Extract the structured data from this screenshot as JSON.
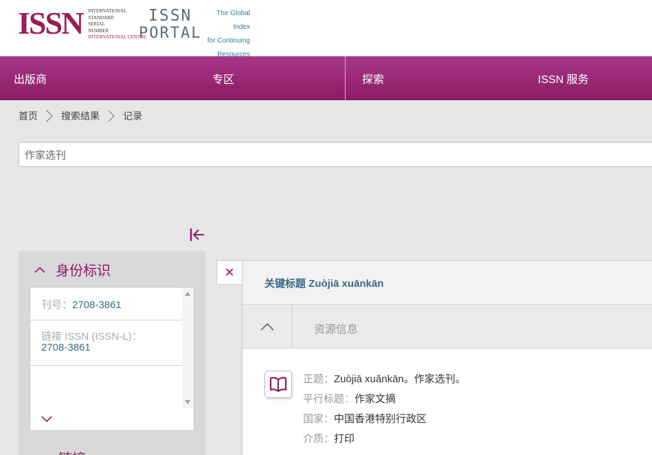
{
  "logo": {
    "issn_letters": "ISSN",
    "lines": [
      "INTERNATIONAL",
      "STANDARD",
      "SERIAL",
      "NUMBER",
      "INTERNATIONAL CENTRE"
    ],
    "portal_issn": "ISSN",
    "portal_word": "PORTAL",
    "tagline": [
      "The Global Index",
      "for Continuing",
      "Resources"
    ]
  },
  "nav": [
    "出版商",
    "专区",
    "探索",
    "ISSN 服务"
  ],
  "breadcrumb": [
    "首页",
    "搜索结果",
    "记录"
  ],
  "search": {
    "value": "作家选刊"
  },
  "identity": {
    "title": "身份标识",
    "issn_label": "刊号：",
    "issn_value": "2708-3861",
    "linking_label": "链接 ISSN (ISSN-L)：",
    "linking_value": "2708-3861",
    "next_section": "链接"
  },
  "record": {
    "key_title": "关键标题 Zuòjiā xuānkān",
    "section_title": "资源信息",
    "fields": [
      {
        "label": "正题：",
        "value": "Zuòjiā xuǎnkān。作家选刊。"
      },
      {
        "label": "平行标题：",
        "value": "作家文摘"
      },
      {
        "label": "国家：",
        "value": "中国香港特别行政区"
      },
      {
        "label": "介质：",
        "value": "打印"
      }
    ]
  },
  "colors": {
    "brand": "#8c1b64",
    "link": "#3a6b85"
  },
  "icons": {
    "close": "close-icon",
    "book": "book-icon",
    "collapse": "collapse-sidebar-icon"
  }
}
